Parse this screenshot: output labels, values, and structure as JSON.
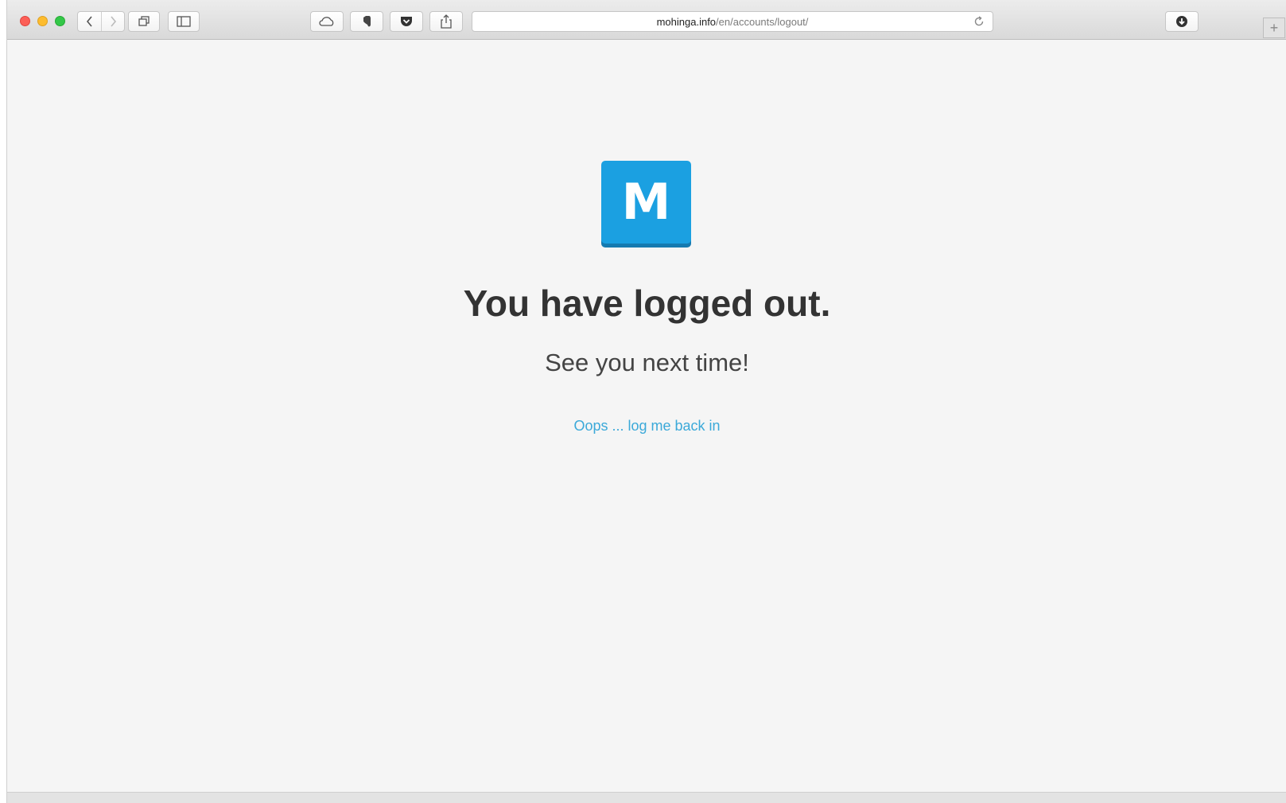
{
  "browser": {
    "url_host": "mohinga.info",
    "url_path": "/en/accounts/logout/",
    "new_tab_label": "+",
    "icons": {
      "back": "chevron-left-icon",
      "forward": "chevron-right-icon",
      "tabs": "tabs-overview-icon",
      "sidebar": "sidebar-icon",
      "cloud": "icloud-icon",
      "evernote": "evernote-icon",
      "pocket": "pocket-icon",
      "share": "share-icon",
      "reload": "reload-icon",
      "downloads": "download-icon"
    }
  },
  "page": {
    "logo_letter": "M",
    "headline": "You have logged out.",
    "subline": "See you next time!",
    "relogin_link": "Oops ... log me back in"
  },
  "colors": {
    "logo_blue": "#1ba0e1",
    "link": "#3ba9d9",
    "background": "#f5f5f5"
  }
}
